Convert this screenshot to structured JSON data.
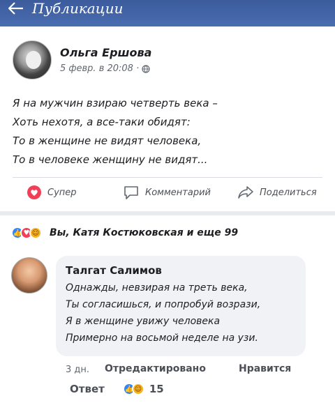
{
  "header": {
    "title": "Публикации",
    "back_icon": "arrow-left-icon",
    "bg_color": "#4267b2"
  },
  "post": {
    "author": "Ольга Ершова",
    "date": "5 февр. в 20:08 ·",
    "privacy_icon": "globe-icon",
    "lines": [
      "Я на мужчин взираю четверть века –",
      "Хоть нехотя, а все-таки обидят:",
      "То в женщине не видят человека,",
      "То в человеке женщину не видят..."
    ],
    "actions": {
      "like_label": "Супер",
      "comment_label": "Комментарий",
      "share_label": "Поделиться"
    }
  },
  "reactions": {
    "text": "Вы, Катя Костюковская и еще 99",
    "icons": [
      "like-reaction-icon",
      "love-reaction-icon",
      "haha-reaction-icon"
    ]
  },
  "comment": {
    "author": "Талгат Салимов",
    "lines": [
      "Однажды, невзирая на треть века,",
      "Ты согласишься, и попробуй возрази,",
      "Я в женщине увижу человека",
      "Примерно на восьмой неделе на узи."
    ],
    "time": "3 дн.",
    "edited": "Отредактировано",
    "like_label": "Нравится",
    "reply_label": "Ответ",
    "reaction_count": "15"
  }
}
